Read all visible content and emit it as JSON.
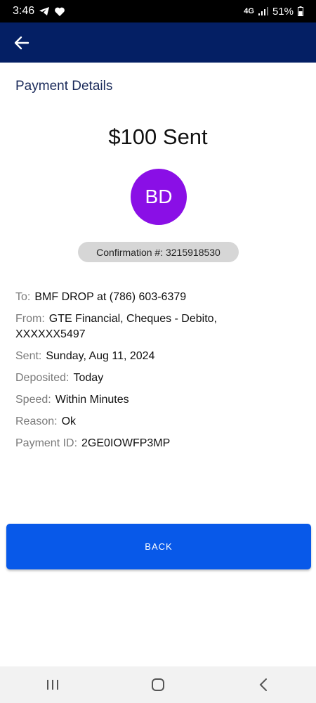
{
  "status": {
    "time": "3:46",
    "network": "4G",
    "battery": "51%"
  },
  "header": {
    "back_icon": "arrow-left-icon"
  },
  "page": {
    "title": "Payment Details",
    "amount": "$100 Sent",
    "avatar_initials": "BD",
    "confirmation": "Confirmation #: 3215918530"
  },
  "details": {
    "to": {
      "label": "To:",
      "value": "BMF DROP at (786) 603-6379"
    },
    "from": {
      "label": "From:",
      "value": "GTE Financial, Cheques - Debito, XXXXXX5497"
    },
    "sent": {
      "label": "Sent:",
      "value": "Sunday, Aug 11, 2024"
    },
    "deposited": {
      "label": "Deposited:",
      "value": "Today"
    },
    "speed": {
      "label": "Speed:",
      "value": "Within Minutes"
    },
    "reason": {
      "label": "Reason:",
      "value": "Ok"
    },
    "payment_id": {
      "label": "Payment ID:",
      "value": "2GE0IOWFP3MP"
    }
  },
  "actions": {
    "back_label": "BACK"
  },
  "colors": {
    "app_bar": "#041f64",
    "avatar": "#8a0fe6",
    "button": "#0859e9"
  }
}
